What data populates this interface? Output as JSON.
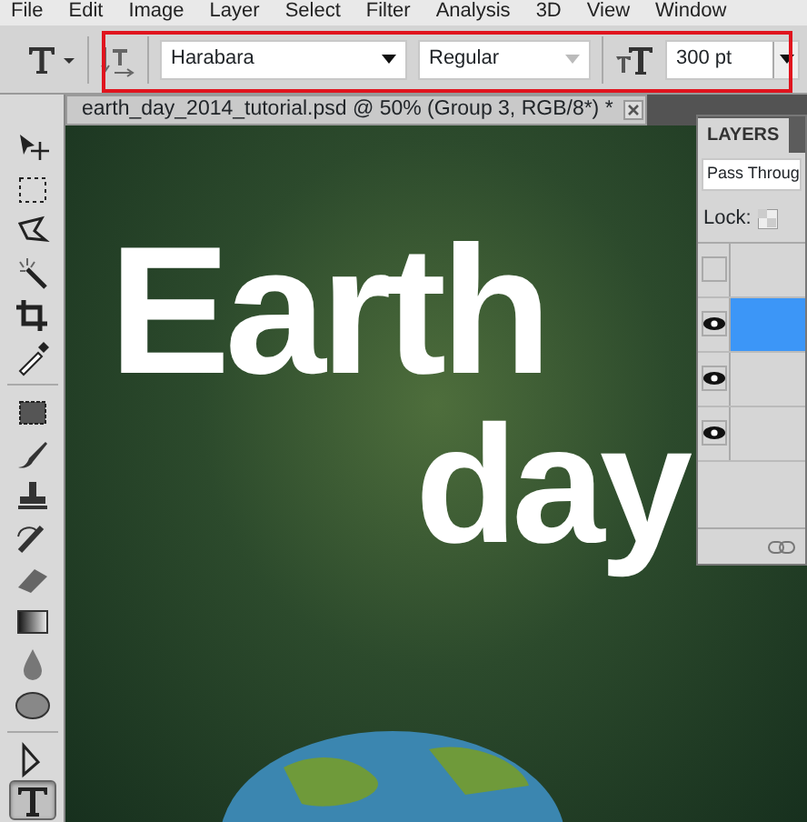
{
  "menu": [
    "File",
    "Edit",
    "Image",
    "Layer",
    "Select",
    "Filter",
    "Analysis",
    "3D",
    "View",
    "Window"
  ],
  "options_bar": {
    "font_family": "Harabara",
    "font_style": "Regular",
    "font_size": "300 pt",
    "highlighted": true
  },
  "document": {
    "tab_title": "earth_day_2014_tutorial.psd @ 50% (Group 3, RGB/8*) *",
    "canvas_text": [
      "Earth",
      "day"
    ]
  },
  "tool_groups": [
    [
      {
        "kind": "move",
        "selected": false
      },
      {
        "kind": "marquee",
        "selected": false
      },
      {
        "kind": "lasso",
        "selected": false
      },
      {
        "kind": "wand",
        "selected": false
      },
      {
        "kind": "crop",
        "selected": false
      },
      {
        "kind": "eyedropper",
        "selected": false
      }
    ],
    [
      {
        "kind": "healing",
        "selected": false
      },
      {
        "kind": "brush",
        "selected": false
      },
      {
        "kind": "stamp",
        "selected": false
      },
      {
        "kind": "history",
        "selected": false
      },
      {
        "kind": "eraser",
        "selected": false
      },
      {
        "kind": "gradient",
        "selected": false
      },
      {
        "kind": "blur",
        "selected": false
      },
      {
        "kind": "sponge",
        "selected": false
      }
    ],
    [
      {
        "kind": "path",
        "selected": false
      },
      {
        "kind": "type",
        "selected": true
      }
    ]
  ],
  "layers_panel": {
    "tab": "LAYERS",
    "blend_mode": "Pass Throug",
    "lock_label": "Lock:",
    "layers": [
      {
        "visible": false,
        "selected": false
      },
      {
        "visible": true,
        "selected": true
      },
      {
        "visible": true,
        "selected": false
      },
      {
        "visible": true,
        "selected": false
      }
    ]
  }
}
